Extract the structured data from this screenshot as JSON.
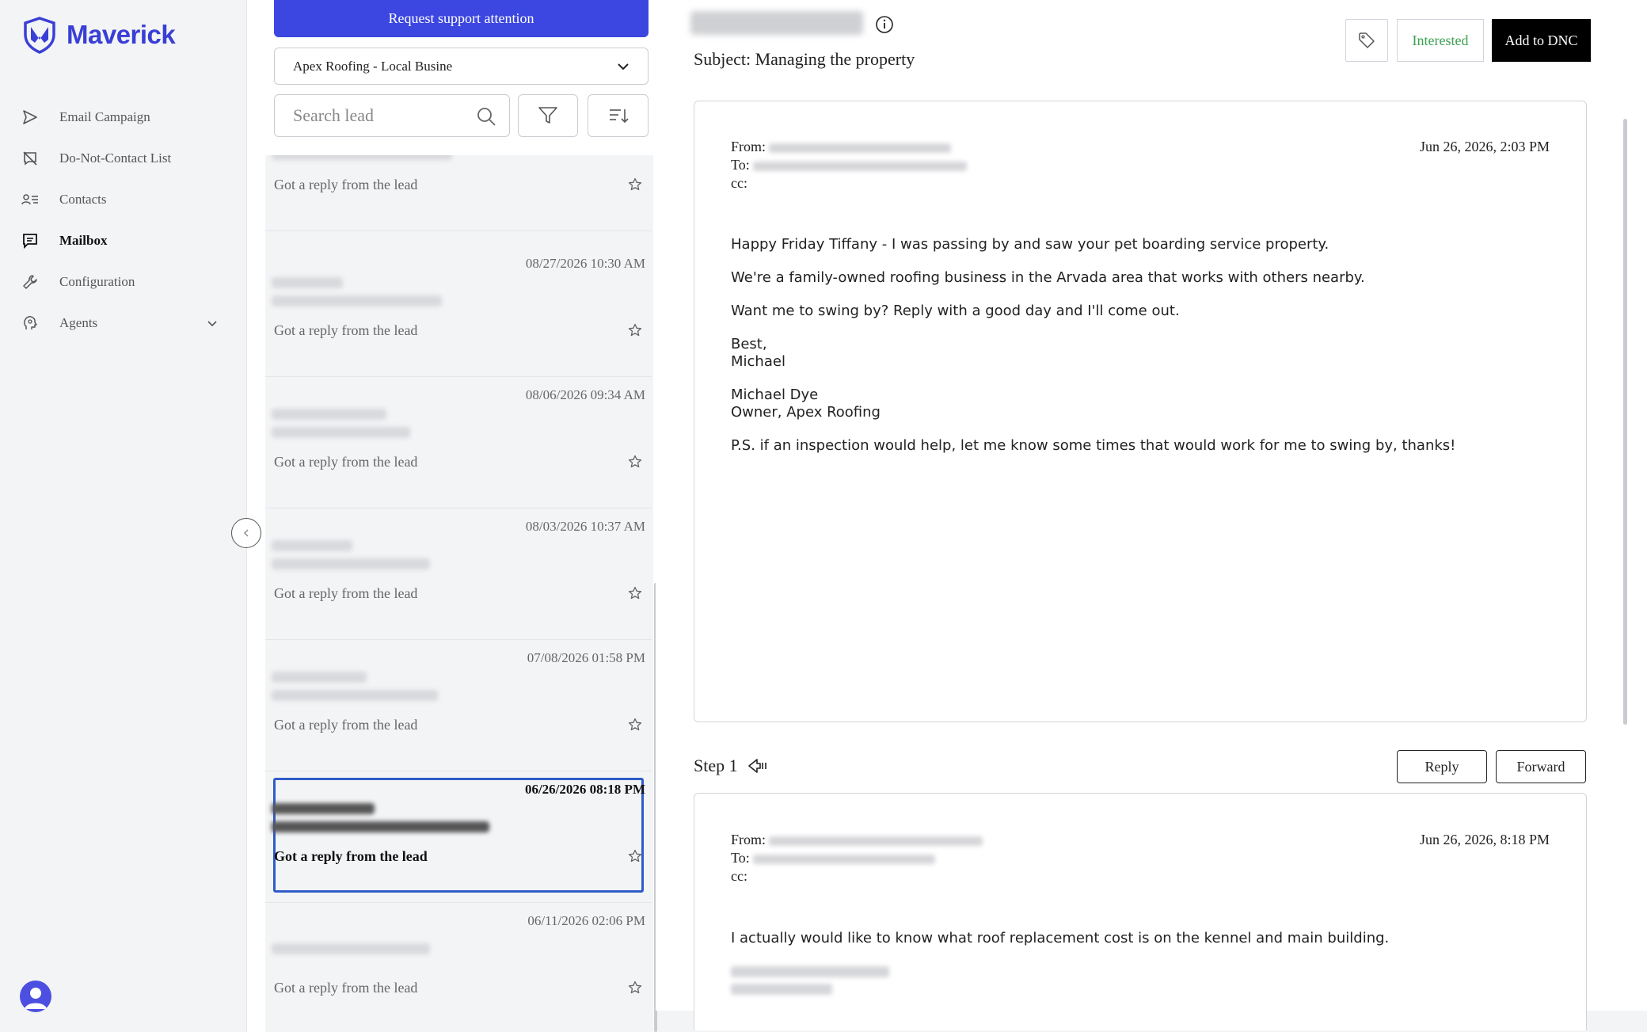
{
  "brand": {
    "name": "Maverick",
    "color": "#3a3fd4"
  },
  "sidebar": {
    "items": [
      {
        "label": "Email Campaign",
        "icon": "send-icon"
      },
      {
        "label": "Do-Not-Contact List",
        "icon": "blocked-message-icon"
      },
      {
        "label": "Contacts",
        "icon": "contacts-list-icon"
      },
      {
        "label": "Mailbox",
        "icon": "message-icon",
        "active": true
      },
      {
        "label": "Configuration",
        "icon": "wrench-icon"
      },
      {
        "label": "Agents",
        "icon": "agent-head-icon",
        "expandable": true
      }
    ]
  },
  "list": {
    "support_label": "Request support attention",
    "campaign_selected": "Apex Roofing - Local Busine",
    "search_placeholder": "Search lead",
    "rows": [
      {
        "date": "",
        "status": "Got a reply from the lead"
      },
      {
        "date": "08/27/2026 10:30 AM",
        "status": "Got a reply from the lead"
      },
      {
        "date": "08/06/2026 09:34 AM",
        "status": "Got a reply from the lead"
      },
      {
        "date": "08/03/2026 10:37 AM",
        "status": "Got a reply from the lead"
      },
      {
        "date": "07/08/2026 01:58 PM",
        "status": "Got a reply from the lead"
      },
      {
        "date": "06/26/2026 08:18 PM",
        "status": "Got a reply from the lead",
        "selected": true
      },
      {
        "date": "06/11/2026 02:06 PM",
        "status": "Got a reply from the lead"
      }
    ]
  },
  "thread": {
    "subject": "Subject: Managing the property",
    "interested_label": "Interested",
    "dnc_label": "Add to DNC",
    "email1": {
      "from_label": "From:",
      "to_label": "To:",
      "cc_label": "cc:",
      "date": "Jun 26, 2026, 2:03 PM",
      "lines": [
        "Happy Friday Tiffany - I was passing by and saw your pet boarding service property.",
        "We're a family-owned roofing business in the Arvada area that works with others nearby.",
        "Want me to swing by? Reply with a good day and I'll come out.",
        "Best,",
        "Michael",
        "Michael Dye",
        "Owner, Apex Roofing",
        "P.S. if an inspection would help, let me know some times that would work for me to swing by, thanks!"
      ]
    },
    "step_label": "Step 1",
    "reply_label": "Reply",
    "forward_label": "Forward",
    "email2": {
      "from_label": "From:",
      "to_label": "To:",
      "cc_label": "cc:",
      "date": "Jun 26, 2026, 8:18 PM",
      "body": "I actually would like to know what roof replacement cost is on the kennel and main building."
    }
  },
  "colors": {
    "primary": "#3c46e0",
    "interested": "#3aa050",
    "selected_border": "#2f5cc8"
  }
}
